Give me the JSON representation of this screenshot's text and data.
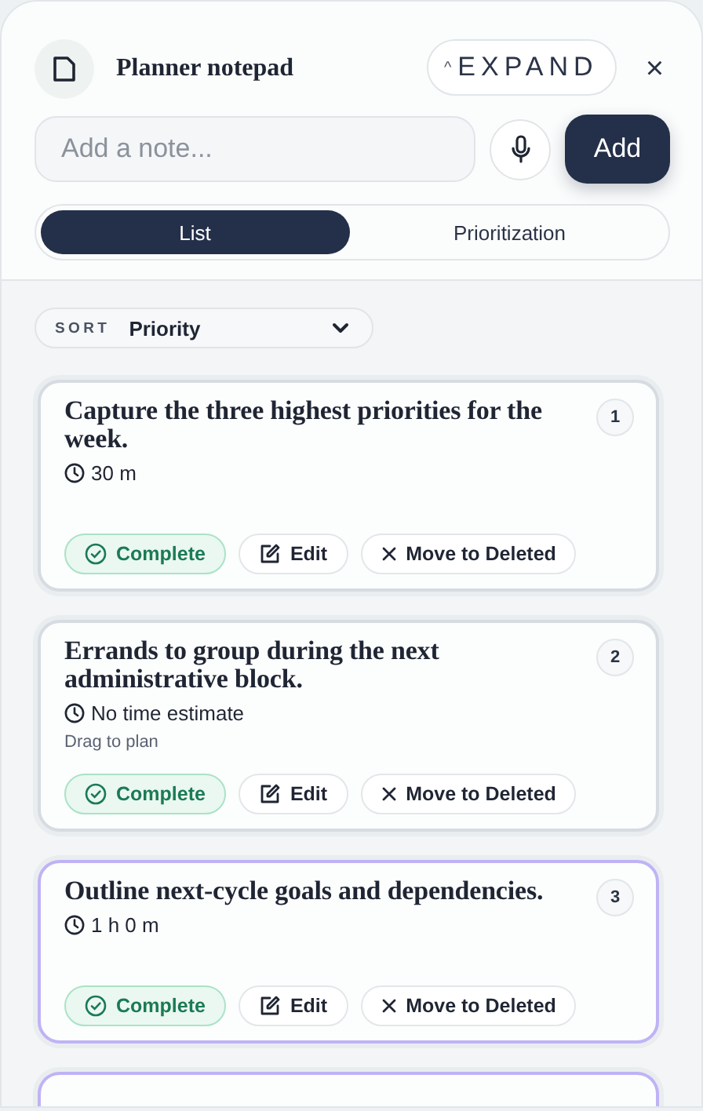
{
  "header": {
    "title": "Planner notepad",
    "expand_label": "EXPAND",
    "expand_caret": "^",
    "close": "×"
  },
  "composer": {
    "placeholder": "Add a note...",
    "add_label": "Add"
  },
  "tabs": [
    {
      "label": "List",
      "selected": true
    },
    {
      "label": "Prioritization",
      "selected": false
    }
  ],
  "sort": {
    "label": "SORT",
    "value": "Priority"
  },
  "notes": [
    {
      "kind": "note",
      "title": "Capture the three highest priorities for the week.",
      "rank": "1",
      "estimate": "30 m",
      "highlighted": false,
      "actions": [
        "Complete",
        "Edit",
        "Move to Deleted"
      ]
    },
    {
      "kind": "note",
      "title": "Errands to group during the next administrative block.",
      "rank": "2",
      "estimate": "No time estimate",
      "hint": "Drag to plan",
      "highlighted": false,
      "actions": [
        "Complete",
        "Edit",
        "Move to Deleted"
      ]
    },
    {
      "kind": "note",
      "title": "Outline next-cycle goals and dependencies.",
      "rank": "3",
      "estimate": "1 h 0 m",
      "highlighted": true,
      "actions": [
        "Complete",
        "Edit",
        "Move to Deleted"
      ]
    },
    {
      "kind": "clipped",
      "highlighted": true
    }
  ]
}
